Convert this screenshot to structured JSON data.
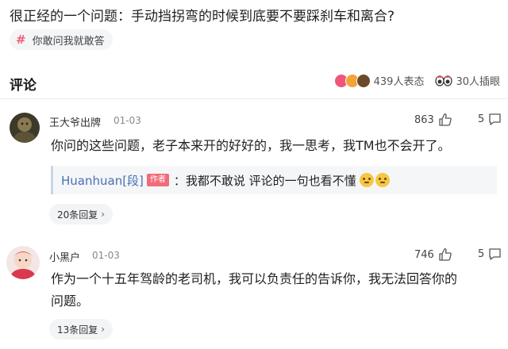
{
  "post": {
    "title": "很正经的一个问题：手动挡拐弯的时候到底要不要踩刹车和离合?",
    "topic_tag": "你敢问我就敢答"
  },
  "comments_header": {
    "title": "评论",
    "reactions_text": "439人表态",
    "insert_eye_text": "30人插眼"
  },
  "comments": [
    {
      "username": "王大爷出牌",
      "date": "01-03",
      "likes": "863",
      "reply_count": "5",
      "text": "你问的这些问题，老子本来开的好好的，我一思考，我TM也不会开了。",
      "quote": {
        "name": "Huanhuan[段]",
        "badge": "作者",
        "text": "：我都不敢说  评论的一句也看不懂"
      },
      "replies_label": "20条回复"
    },
    {
      "username": "小黑户",
      "date": "01-03",
      "likes": "746",
      "reply_count": "5",
      "text_line1": "作为一个十五年驾龄的老司机，我可以负责任的告诉你，我无法回答你的",
      "text_line2": "问题。",
      "replies_label": "13条回复"
    }
  ],
  "colors": {
    "accent_pink": "#f25d7a",
    "link_blue": "#4a6fb5",
    "author_badge": "#f26b7a"
  }
}
